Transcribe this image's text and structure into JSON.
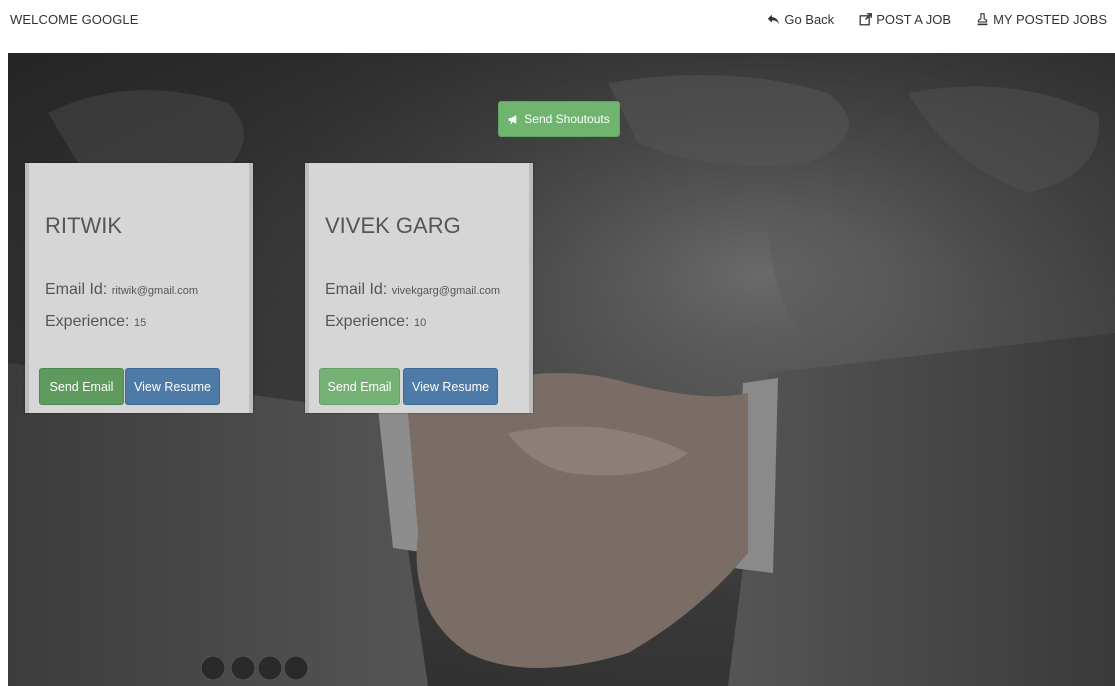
{
  "navbar": {
    "brand": "WELCOME GOOGLE",
    "links": [
      {
        "label": "Go Back",
        "icon": "reply-icon"
      },
      {
        "label": "POST A JOB",
        "icon": "external-edit-icon"
      },
      {
        "label": "MY POSTED JOBS",
        "icon": "stamp-icon"
      }
    ]
  },
  "shoutouts": {
    "label": "Send Shoutouts",
    "icon": "bullhorn-icon",
    "color": "#6fb56f"
  },
  "candidates": [
    {
      "name": "RITWIK",
      "email_label": "Email Id:",
      "email": "ritwik@gmail.com",
      "experience_label": "Experience:",
      "experience": "15",
      "send_email_label": "Send Email",
      "view_resume_label": "View Resume"
    },
    {
      "name": "VIVEK GARG",
      "email_label": "Email Id:",
      "email": "vivekgarg@gmail.com",
      "experience_label": "Experience:",
      "experience": "10",
      "send_email_label": "Send Email",
      "view_resume_label": "View Resume"
    }
  ],
  "colors": {
    "success": "#5e9a5e",
    "primary": "#4d7aa6",
    "card_bg": "#d6d6d6"
  }
}
